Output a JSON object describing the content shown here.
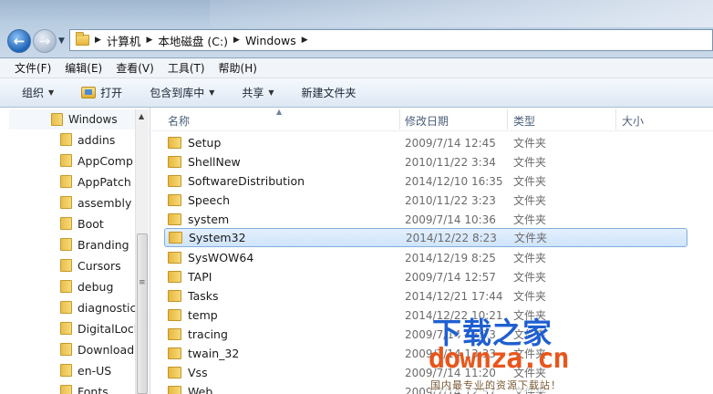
{
  "address": {
    "crumbs": [
      "计算机",
      "本地磁盘 (C:)",
      "Windows"
    ]
  },
  "menu": [
    "文件(F)",
    "编辑(E)",
    "查看(V)",
    "工具(T)",
    "帮助(H)"
  ],
  "toolbar": {
    "organize": "组织",
    "open": "打开",
    "include_library": "包含到库中",
    "share": "共享",
    "new_folder": "新建文件夹"
  },
  "tree": {
    "root": "Windows",
    "items": [
      "addins",
      "AppComp",
      "AppPatch",
      "assembly",
      "Boot",
      "Branding",
      "Cursors",
      "debug",
      "diagnostic",
      "DigitalLock",
      "Download",
      "en-US",
      "Fonts"
    ]
  },
  "columns": {
    "name": "名称",
    "date": "修改日期",
    "type": "类型",
    "size": "大小"
  },
  "files": [
    {
      "name": "Setup",
      "date": "2009/7/14 12:45",
      "type": "文件夹"
    },
    {
      "name": "ShellNew",
      "date": "2010/11/22 3:34",
      "type": "文件夹"
    },
    {
      "name": "SoftwareDistribution",
      "date": "2014/12/10 16:35",
      "type": "文件夹"
    },
    {
      "name": "Speech",
      "date": "2010/11/22 3:23",
      "type": "文件夹"
    },
    {
      "name": "system",
      "date": "2009/7/14 10:36",
      "type": "文件夹"
    },
    {
      "name": "System32",
      "date": "2014/12/22 8:23",
      "type": "文件夹"
    },
    {
      "name": "SysWOW64",
      "date": "2014/12/19 8:25",
      "type": "文件夹"
    },
    {
      "name": "TAPI",
      "date": "2009/7/14 12:57",
      "type": "文件夹"
    },
    {
      "name": "Tasks",
      "date": "2014/12/21 17:44",
      "type": "文件夹"
    },
    {
      "name": "temp",
      "date": "2014/12/22 10:21",
      "type": "文件夹"
    },
    {
      "name": "tracing",
      "date": "2009/7/14 13:33",
      "type": "文件夹"
    },
    {
      "name": "twain_32",
      "date": "2009/7/14 13:33",
      "type": "文件夹"
    },
    {
      "name": "Vss",
      "date": "2009/7/14 11:20",
      "type": "文件夹"
    },
    {
      "name": "Web",
      "date": "2009/7/14 12:57",
      "type": "文件夹"
    }
  ],
  "watermark": {
    "title": "下载之家",
    "domain": "downza.cn",
    "slogan": "国内最专业的资源下载站！"
  }
}
